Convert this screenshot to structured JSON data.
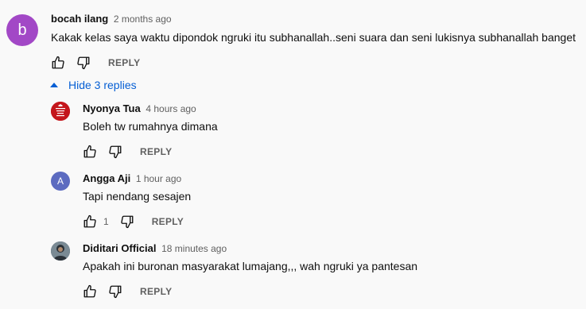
{
  "main_comment": {
    "avatar_letter": "b",
    "avatar_color": "#a248c6",
    "author": "bocah ilang",
    "time": "2 months ago",
    "text": "Kakak kelas saya waktu dipondok ngruki itu subhanallah..seni suara dan seni lukisnya subhanallah banget",
    "reply_label": "REPLY"
  },
  "replies_toggle": {
    "label": "Hide 3 replies",
    "icon": "caret-up-icon",
    "color": "#065fd4"
  },
  "replies": [
    {
      "author": "Nyonya Tua",
      "time": "4 hours ago",
      "text": "Boleh tw rumahnya dimana",
      "reply_label": "REPLY",
      "avatar_text": "KEEP CALM AND SAY UNCOO",
      "avatar_color": "#c4161c"
    },
    {
      "author": "Angga Aji",
      "time": "1 hour ago",
      "text": "Tapi nendang sesajen",
      "likes": "1",
      "reply_label": "REPLY",
      "avatar_letter": "A",
      "avatar_color": "#5c6bc0"
    },
    {
      "author": "Diditari Official",
      "time": "18 minutes ago",
      "text": "Apakah ini buronan masyarakat lumajang,,, wah ngruki ya pantesan",
      "reply_label": "REPLY",
      "avatar_color": "#3d4f5c"
    }
  ]
}
